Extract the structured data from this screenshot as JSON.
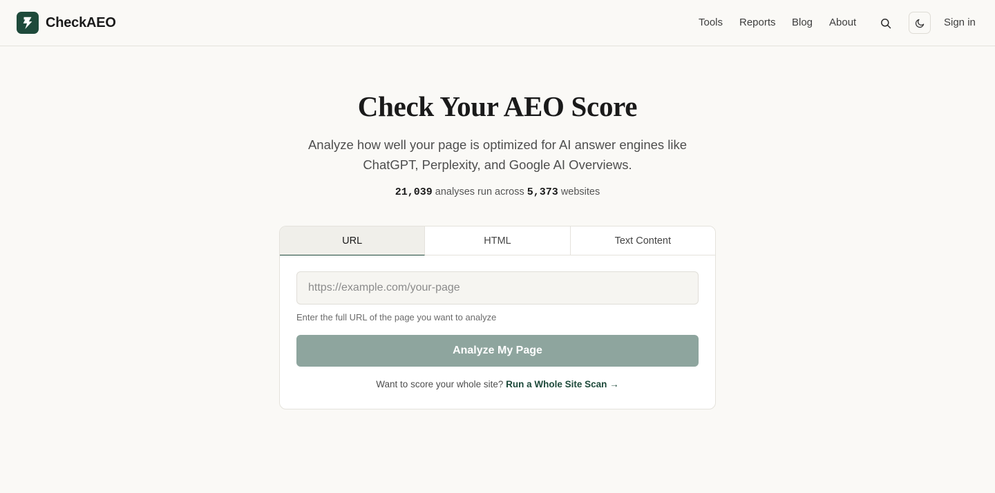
{
  "header": {
    "logo_text": "CheckAEO",
    "nav": {
      "tools": "Tools",
      "reports": "Reports",
      "blog": "Blog",
      "about": "About"
    },
    "sign_in": "Sign in"
  },
  "hero": {
    "title": "Check Your AEO Score",
    "subtitle": "Analyze how well your page is optimized for AI answer engines like ChatGPT, Perplexity, and Google AI Overviews.",
    "stats": {
      "analyses_count": "21,039",
      "analyses_text": "analyses run across",
      "websites_count": "5,373",
      "websites_text": "websites"
    }
  },
  "form": {
    "tabs": [
      "URL",
      "HTML",
      "Text Content"
    ],
    "active_tab": "URL",
    "url_input": {
      "value": "",
      "placeholder": "https://example.com/your-page"
    },
    "hint": "Enter the full URL of the page you want to analyze",
    "submit_label": "Analyze My Page",
    "footer_text": "Want to score your whole site?",
    "footer_link": "Run a Whole Site Scan →"
  },
  "colors": {
    "background": "#faf9f6",
    "brand": "#1e4a3b",
    "button_disabled": "#8ea59e"
  },
  "icons": {
    "logo": "bolt-icon",
    "search": "search-icon",
    "theme": "moon-icon"
  }
}
